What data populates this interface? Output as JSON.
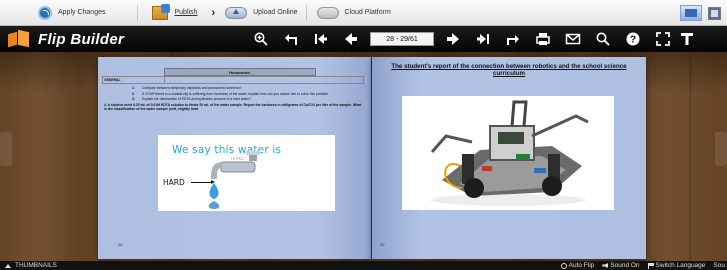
{
  "toolbar": {
    "apply_changes": "Apply Changes",
    "publish": "Publish",
    "upload_online": "Upload Online",
    "cloud_platform": "Cloud Platform"
  },
  "header": {
    "brand": "Flip Builder",
    "page_indicator": "28 - 29/61"
  },
  "left_page": {
    "homework_title": "Homework:",
    "cell_left": "GENERAL",
    "questions": [
      {
        "num": "1.",
        "text": "Compare between temporary hardness and permanent hardness?"
      },
      {
        "num": "2.",
        "text": "If YOUR friend in a coastal city is suffering from hardness of the water, explain how can you advise him to solve this problem"
      },
      {
        "num": "3.",
        "text": "Explain the mechanism of EDTA during titration process of a hard water?"
      }
    ],
    "extra": "4. A student used 6.25 mL of 0.01M EDTA solution to titrate 20 mL of the water sample. Report the hardness in milligrams of CaCO3 per liter of the sample. What is the classification of the water sample (soft, slightly hard",
    "water_title": "We say this water is",
    "water_sub": "HARD",
    "water_label": "HARD",
    "page_number": "28"
  },
  "right_page": {
    "title": "The student's report of the connection between robotics and the school science curriculum",
    "page_number": "29"
  },
  "bottom": {
    "thumbnails": "THUMBNAILS",
    "auto_flip": "Auto Flip",
    "sound": "Sound On",
    "language": "Switch Language",
    "sound_toggle": "Sou"
  },
  "colors": {
    "accent_orange": "#f5a238",
    "page_blue": "#aebfe2",
    "water_text": "#1fa7d8"
  }
}
